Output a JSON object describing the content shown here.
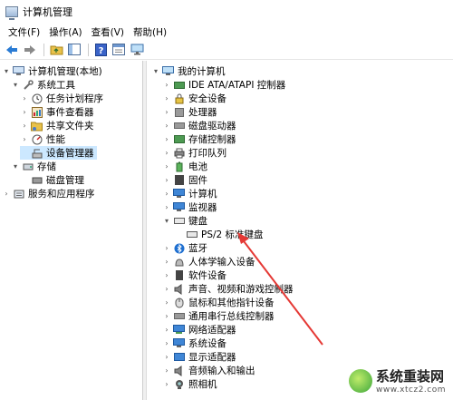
{
  "window": {
    "title": "计算机管理"
  },
  "menu": [
    "文件(F)",
    "操作(A)",
    "查看(V)",
    "帮助(H)"
  ],
  "toolbar": {
    "buttons": [
      "back-icon",
      "forward-icon",
      "up-folder-icon",
      "show-hide-tree-icon",
      "help-icon",
      "properties-icon",
      "monitor-icon"
    ]
  },
  "left_tree": {
    "root": "计算机管理(本地)",
    "system_tools": "系统工具",
    "system_children": [
      "任务计划程序",
      "事件查看器",
      "共享文件夹",
      "性能",
      "设备管理器"
    ],
    "storage": "存储",
    "storage_children": [
      "磁盘管理"
    ],
    "services": "服务和应用程序"
  },
  "right_tree": {
    "root": "我的计算机",
    "categories": [
      "IDE ATA/ATAPI 控制器",
      "安全设备",
      "处理器",
      "磁盘驱动器",
      "存储控制器",
      "打印队列",
      "电池",
      "固件",
      "计算机",
      "监视器",
      "键盘",
      "PS/2 标准键盘",
      "蓝牙",
      "人体学输入设备",
      "软件设备",
      "声音、视频和游戏控制器",
      "鼠标和其他指针设备",
      "通用串行总线控制器",
      "网络适配器",
      "系统设备",
      "显示适配器",
      "音频输入和输出",
      "照相机"
    ]
  },
  "watermark": {
    "title": "系统重装网",
    "url": "www.xtcz2.com"
  },
  "colors": {
    "selection": "#cce8ff",
    "annotation_arrow": "#e53935"
  }
}
